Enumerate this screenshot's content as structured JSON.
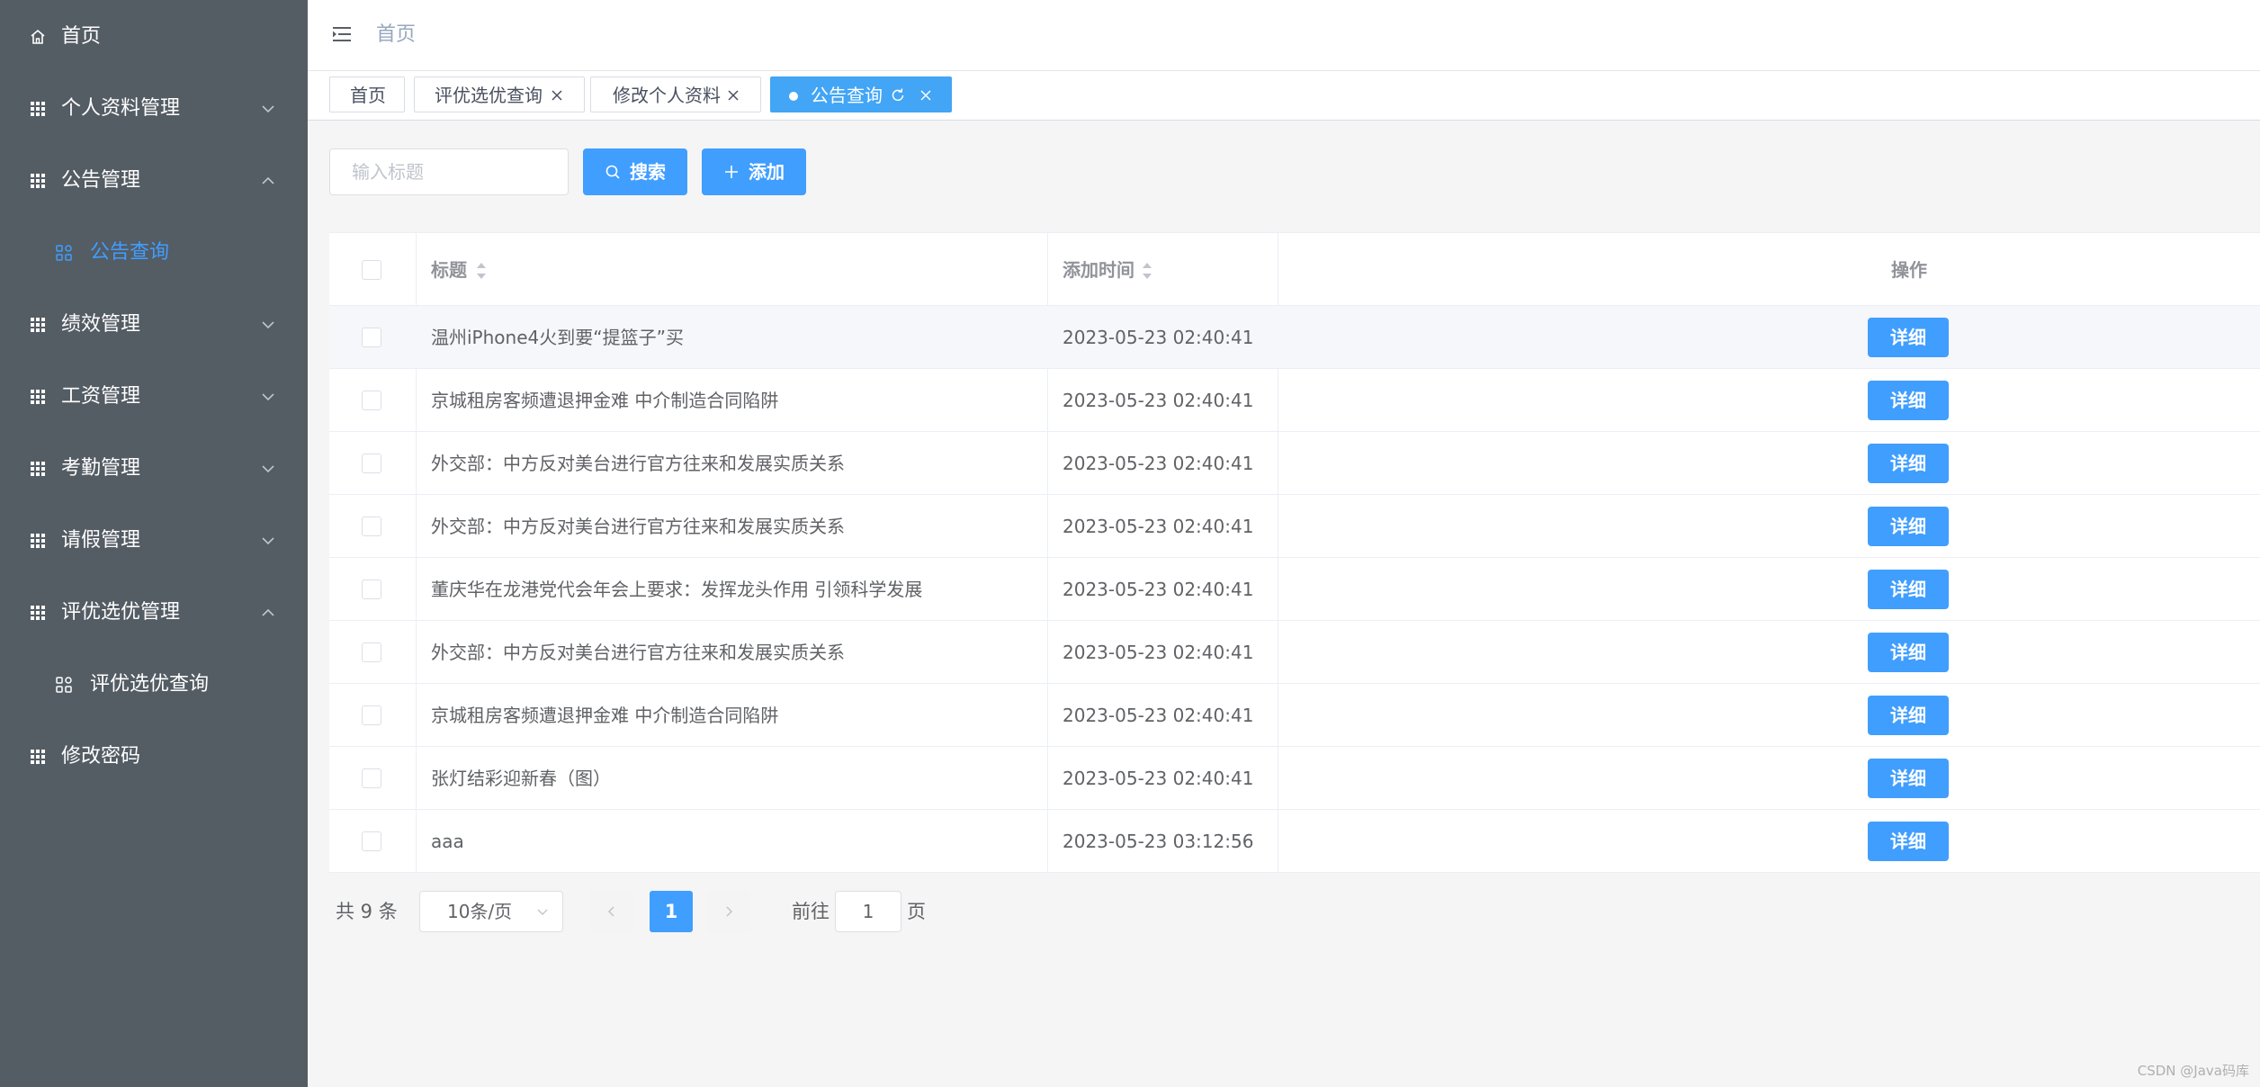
{
  "sidebar": {
    "items": [
      {
        "label": "首页",
        "icon": "home-icon"
      },
      {
        "label": "个人资料管理",
        "icon": "grid-icon",
        "expanded": false
      },
      {
        "label": "公告管理",
        "icon": "grid-icon",
        "expanded": true
      },
      {
        "label": "公告查询",
        "icon": "apps-icon",
        "active": true
      },
      {
        "label": "绩效管理",
        "icon": "grid-icon",
        "expanded": false
      },
      {
        "label": "工资管理",
        "icon": "grid-icon",
        "expanded": false
      },
      {
        "label": "考勤管理",
        "icon": "grid-icon",
        "expanded": false
      },
      {
        "label": "请假管理",
        "icon": "grid-icon",
        "expanded": false
      },
      {
        "label": "评优选优管理",
        "icon": "grid-icon",
        "expanded": true
      },
      {
        "label": "评优选优查询",
        "icon": "apps-icon"
      },
      {
        "label": "修改密码",
        "icon": "grid-icon"
      }
    ]
  },
  "header": {
    "breadcrumb": "首页"
  },
  "tags": [
    {
      "label": "首页"
    },
    {
      "label": "评优选优查询"
    },
    {
      "label": "修改个人资料"
    },
    {
      "label": "公告查询",
      "active": true
    }
  ],
  "toolbar": {
    "search_placeholder": "输入标题",
    "search_label": "搜索",
    "add_label": "添加"
  },
  "table": {
    "columns": [
      "标题",
      "添加时间",
      "操作"
    ],
    "rows": [
      {
        "title": "温州iPhone4火到要“提篮子”买",
        "time": "2023-05-23 02:40:41",
        "action": "详细"
      },
      {
        "title": "京城租房客频遭退押金难 中介制造合同陷阱",
        "time": "2023-05-23 02:40:41",
        "action": "详细"
      },
      {
        "title": "外交部：中方反对美台进行官方往来和发展实质关系",
        "time": "2023-05-23 02:40:41",
        "action": "详细"
      },
      {
        "title": "外交部：中方反对美台进行官方往来和发展实质关系",
        "time": "2023-05-23 02:40:41",
        "action": "详细"
      },
      {
        "title": "董庆华在龙港党代会年会上要求：发挥龙头作用 引领科学发展",
        "time": "2023-05-23 02:40:41",
        "action": "详细"
      },
      {
        "title": "外交部：中方反对美台进行官方往来和发展实质关系",
        "time": "2023-05-23 02:40:41",
        "action": "详细"
      },
      {
        "title": "京城租房客频遭退押金难 中介制造合同陷阱",
        "time": "2023-05-23 02:40:41",
        "action": "详细"
      },
      {
        "title": "张灯结彩迎新春（图）",
        "time": "2023-05-23 02:40:41",
        "action": "详细"
      },
      {
        "title": "aaa",
        "time": "2023-05-23 03:12:56",
        "action": "详细"
      }
    ]
  },
  "pagination": {
    "total": "共 9 条",
    "page_size": "10条/页",
    "current_page": "1",
    "goto_prefix": "前往",
    "goto_value": "1",
    "goto_suffix": "页"
  },
  "watermark": "CSDN @Java码库",
  "colors": {
    "sidebar_bg": "#545c64",
    "accent": "#409eff",
    "tag_active": "#42a5f5"
  }
}
